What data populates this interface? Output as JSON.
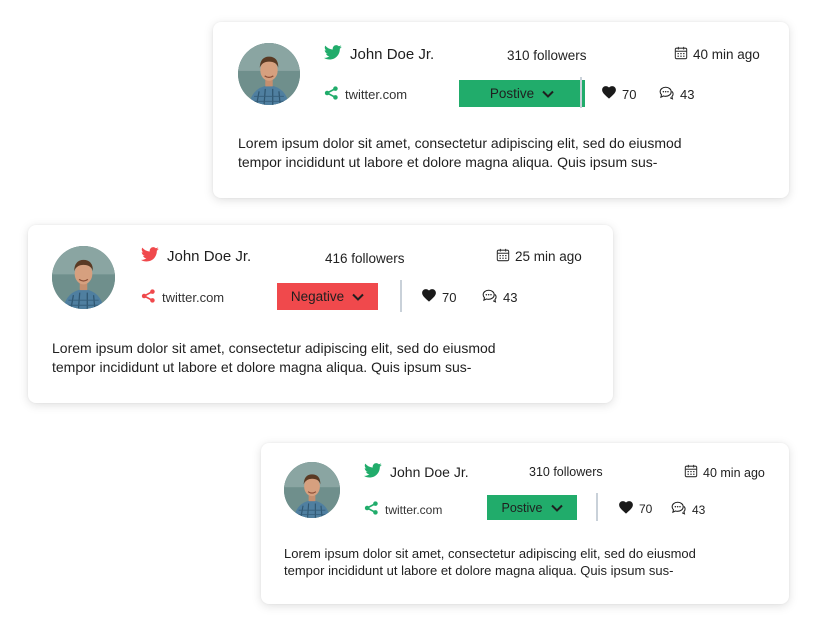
{
  "posts": [
    {
      "author": "John Doe Jr.",
      "followers": "310 followers",
      "time": "40 min ago",
      "source": "twitter.com",
      "sentiment": "Postive",
      "likes": "70",
      "comments": "43",
      "text_line1": "Lorem ipsum dolor sit amet, consectetur adipiscing elit, sed do eiusmod",
      "text_line2": "tempor incididunt ut labore et dolore magna aliqua. Quis ipsum sus-",
      "accent_color": "#21ac6b",
      "twitter_icon": "twitter-bird-icon",
      "source_icon": "share-icon"
    },
    {
      "author": "John Doe Jr.",
      "followers": "416 followers",
      "time": "25 min ago",
      "source": "twitter.com",
      "sentiment": "Negative",
      "likes": "70",
      "comments": "43",
      "text_line1": "Lorem ipsum dolor sit amet, consectetur adipiscing elit, sed do eiusmod",
      "text_line2": "tempor incididunt ut labore et dolore magna aliqua. Quis ipsum sus-",
      "accent_color": "#f0494c",
      "twitter_icon": "twitter-bird-icon",
      "source_icon": "share-icon"
    },
    {
      "author": "John Doe Jr.",
      "followers": "310 followers",
      "time": "40 min ago",
      "source": "twitter.com",
      "sentiment": "Postive",
      "likes": "70",
      "comments": "43",
      "text_line1": "Lorem ipsum dolor sit amet, consectetur adipiscing elit, sed do eiusmod",
      "text_line2": "tempor incididunt ut labore et dolore magna aliqua. Quis ipsum sus-",
      "accent_color": "#21ac6b",
      "twitter_icon": "twitter-bird-icon",
      "source_icon": "share-icon"
    }
  ],
  "colors": {
    "positive": "#21ac6b",
    "negative": "#f0494c",
    "text": "#1f1f1f",
    "divider": "#c9d1d9"
  },
  "icons": {
    "calendar": "calendar-icon",
    "heart": "heart-icon",
    "comment": "comment-icon",
    "chevron": "chevron-down-icon"
  }
}
